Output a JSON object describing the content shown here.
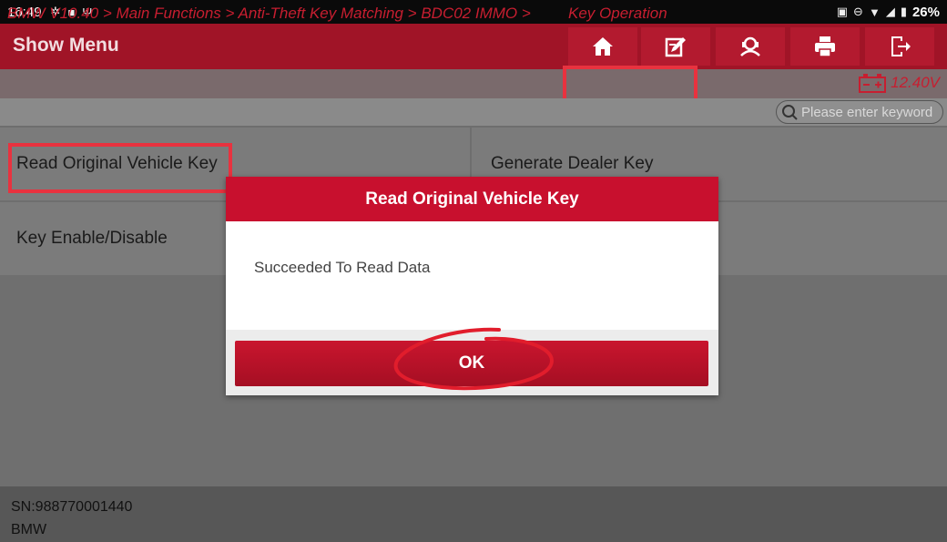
{
  "status_bar": {
    "time": "16:49",
    "battery": "26%"
  },
  "header": {
    "title": "Show Menu"
  },
  "toolbar": {
    "icons": [
      "home-icon",
      "edit-report-icon",
      "user-support-icon",
      "print-icon",
      "exit-icon"
    ]
  },
  "breadcrumb": {
    "path": "BMW V10.40 > Main Functions  > Anti-Theft Key Matching > BDC02 IMMO > ",
    "current": "Key Operation"
  },
  "voltage": "12.40V",
  "search": {
    "placeholder": "Please enter keyword"
  },
  "menu": {
    "items": [
      "Read Original Vehicle Key",
      "Generate Dealer Key",
      "Key Enable/Disable"
    ]
  },
  "dialog": {
    "title": "Read Original Vehicle Key",
    "message": "Succeeded To Read Data",
    "ok_label": "OK"
  },
  "footer": {
    "sn": "SN:988770001440",
    "model": "BMW"
  },
  "colors": {
    "brand_red": "#c8102e",
    "annotation_red": "#e8323f"
  }
}
